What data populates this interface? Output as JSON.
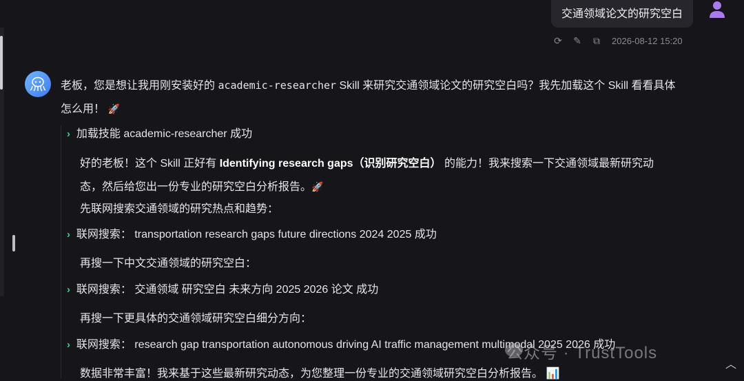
{
  "user_message": {
    "text": "交通领域论文的研究空白",
    "timestamp": "2026-08-12 15:20",
    "actions": [
      "refresh-icon",
      "edit-icon",
      "copy-icon"
    ]
  },
  "assistant": {
    "intro_line1_a": "老板，您是想让我用刚安装好的 ",
    "skill_name": "academic-researcher",
    "intro_line1_b": " Skill 来研究交通领域论文的研究空白吗？我先加载这个 Skill 看看具体",
    "intro_line2": "怎么用！",
    "step_load": "加载技能 academic-researcher 成功",
    "para1_a": "好的老板！这个 Skill 正好有 ",
    "para1_bold": "Identifying research gaps（识别研究空白）",
    "para1_b": " 的能力！我来搜索一下交通领域最新研究动",
    "para1_line2": "态，然后给您出一份专业的研究空白分析报告。",
    "para2": "先联网搜索交通领域的研究热点和趋势：",
    "search1": "联网搜索： transportation research gaps future directions 2024 2025 成功",
    "para3": "再搜一下中文交通领域的研究空白：",
    "search2": "联网搜索： 交通领域 研究空白 未来方向 2025 2026 论文 成功",
    "para4": "再搜一下更具体的交通领域研究空白细分方向：",
    "search3": "联网搜索： research gap transportation autonomous driving AI traffic management multimodal 2025 2026 成功",
    "para5": "数据非常丰富！我来基于这些最新研究动态，为您整理一份专业的交通领域研究空白分析报告。"
  },
  "watermark": "公众号 · TrustTools",
  "colors": {
    "background": "#16161a",
    "accent_green": "#3fcf8e",
    "user_avatar": "#a97bf0",
    "bot_avatar": "#4d90f7"
  }
}
